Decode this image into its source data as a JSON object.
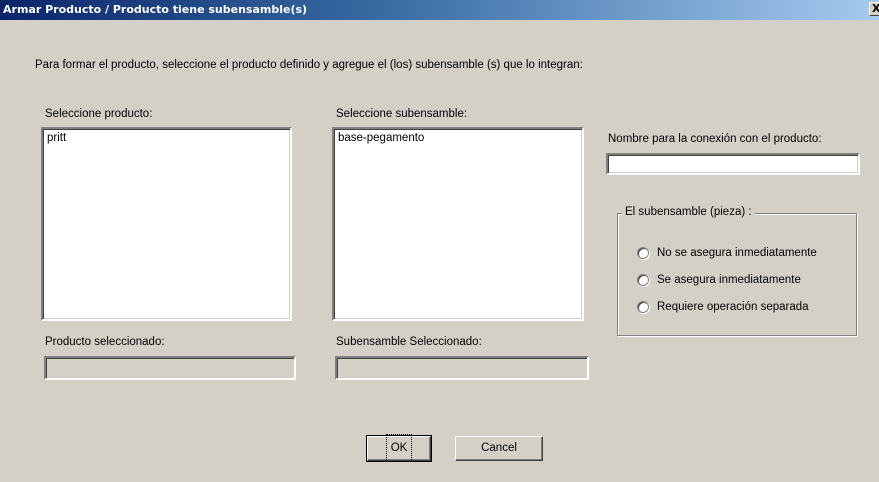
{
  "window": {
    "title": "Armar Producto / Producto tiene subensamble(s)",
    "close_label": "X"
  },
  "instructions": "Para formar el producto, seleccione el producto definido y agregue el (los) subensamble (s) que lo integran:",
  "product_list": {
    "label": "Seleccione producto:",
    "items": [
      "pritt"
    ]
  },
  "subassembly_list": {
    "label": "Seleccione subensamble:",
    "items": [
      "base-pegamento"
    ]
  },
  "connection_name": {
    "label": "Nombre para la conexión con el producto:",
    "value": ""
  },
  "subassembly_group": {
    "legend": "El subensamble (pieza) :",
    "options": [
      "No se asegura inmediatamente",
      "Se asegura inmediatamente",
      "Requiere operación separada"
    ]
  },
  "selected_product": {
    "label": "Producto seleccionado:",
    "value": ""
  },
  "selected_subassembly": {
    "label": "Subensamble Seleccionado:",
    "value": ""
  },
  "buttons": {
    "ok": "OK",
    "cancel": "Cancel"
  }
}
